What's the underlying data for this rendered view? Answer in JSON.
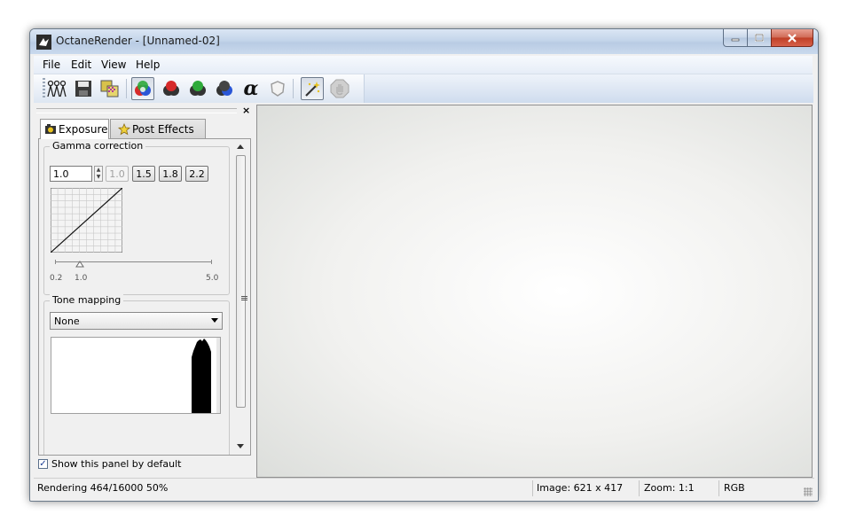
{
  "window": {
    "title": "OctaneRender - [Unnamed-02]",
    "buttons": {
      "minimize": "minimize-icon",
      "maximize": "maximize-icon",
      "close": "close-icon"
    }
  },
  "menu": [
    "File",
    "Edit",
    "View",
    "Help"
  ],
  "toolbar": {
    "icons": [
      "nodes-icon",
      "save-icon",
      "texture-icon",
      "rgb-spheres-icon",
      "red-sphere-icon",
      "green-sphere-icon",
      "blue-sphere-icon",
      "alpha-icon",
      "shield-icon",
      "magic-wand-icon",
      "stop-icon"
    ],
    "alpha_glyph": "α"
  },
  "panel": {
    "close_glyph": "×",
    "tabs": [
      {
        "label": "Exposure",
        "icon": "camera-icon",
        "active": true
      },
      {
        "label": "Post Effects",
        "icon": "star-icon",
        "active": false
      }
    ],
    "gamma": {
      "title": "Gamma correction",
      "value": "1.0",
      "presets": [
        {
          "label": "1.0",
          "enabled": false
        },
        {
          "label": "1.5",
          "enabled": true
        },
        {
          "label": "1.8",
          "enabled": true
        },
        {
          "label": "2.2",
          "enabled": true
        }
      ],
      "slider": {
        "min_label": "0.2",
        "value_label": "1.0",
        "max_label": "5.0"
      }
    },
    "tone_mapping": {
      "title": "Tone mapping",
      "selected": "None"
    },
    "show_default": {
      "label": "Show this panel by default",
      "checked": true,
      "checkmark": "✓"
    }
  },
  "status": {
    "rendering": "Rendering 464/16000 50%",
    "image": "Image: 621 x 417",
    "zoom": "Zoom: 1:1",
    "mode": "RGB"
  },
  "colors": {
    "titlebar": "#c4d5ea",
    "close_button": "#c44a32",
    "viewport": "#f1f1ef"
  }
}
